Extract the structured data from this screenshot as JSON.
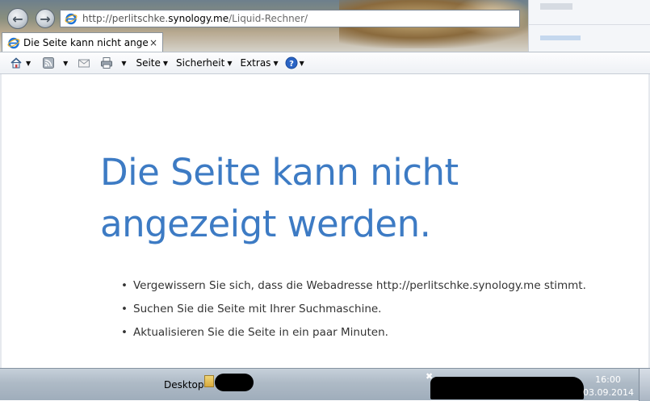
{
  "browser": {
    "address": {
      "prefix": "http://perlitschke.",
      "host": "synology.me",
      "path": "/Liquid-Rechner/"
    },
    "tab": {
      "title": "Die Seite kann nicht angeze...",
      "close": "×"
    },
    "commandbar": {
      "seite": "Seite",
      "sicherheit": "Sicherheit",
      "extras": "Extras"
    }
  },
  "error_page": {
    "title": "Die Seite kann nicht angezeigt werden.",
    "tips": [
      "Vergewissern Sie sich, dass die Webadresse http://perlitschke.synology.me stimmt.",
      "Suchen Sie die Seite mit Ihrer Suchmaschine.",
      "Aktualisieren Sie die Seite in ein paar Minuten."
    ]
  },
  "taskbar": {
    "desktop_label": "Desktop",
    "time": "16:00",
    "date": "03.09.2014"
  },
  "icons": {
    "back": "back-arrow-icon",
    "forward": "forward-arrow-icon",
    "home": "home-icon",
    "feeds": "rss-feed-icon",
    "mail": "mail-icon",
    "print": "printer-icon",
    "help": "help-icon"
  },
  "colors": {
    "title_blue": "#3d7bc4",
    "body_text": "#333333"
  }
}
